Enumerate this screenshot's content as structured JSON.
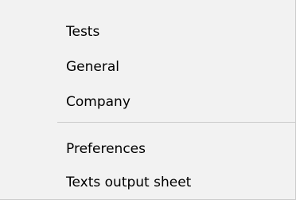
{
  "menu": {
    "items": [
      {
        "label": "Tests"
      },
      {
        "label": "General"
      },
      {
        "label": "Company"
      },
      {
        "label": "Preferences"
      },
      {
        "label": "Texts output sheet"
      }
    ]
  }
}
